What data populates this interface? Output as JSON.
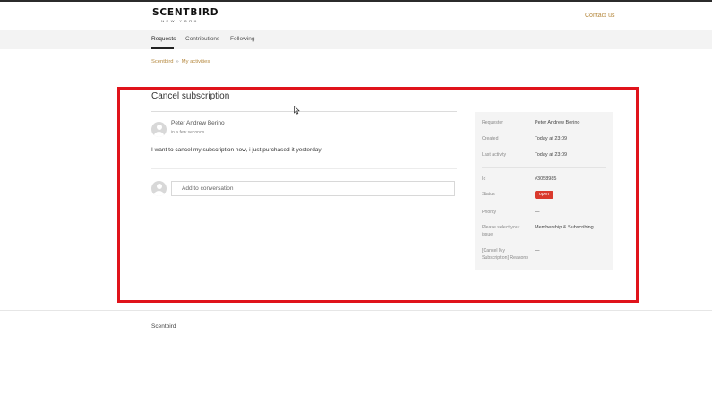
{
  "header": {
    "logo_text": "SCENTBIRD",
    "logo_subtext": "NEW YORK",
    "contact_label": "Contact us"
  },
  "nav": {
    "tabs": [
      {
        "label": "Requests",
        "active": true
      },
      {
        "label": "Contributions",
        "active": false
      },
      {
        "label": "Following",
        "active": false
      }
    ]
  },
  "breadcrumb": {
    "items": [
      "Scentbird",
      "My activities"
    ],
    "separator": "»"
  },
  "request": {
    "title": "Cancel subscription",
    "comment": {
      "author": "Peter Andrew Berino",
      "time": "in a few seconds",
      "body": "I want to cancel my subscription now, i just purchased it yesterday"
    },
    "reply_placeholder": "Add to conversation"
  },
  "details": {
    "requester_label": "Requester",
    "requester_value": "Peter Andrew Berino",
    "created_label": "Created",
    "created_value": "Today at 23:09",
    "activity_label": "Last activity",
    "activity_value": "Today at 23:09",
    "id_label": "Id",
    "id_value": "#3058985",
    "status_label": "Status",
    "status_value": "open",
    "priority_label": "Priority",
    "priority_value": "—",
    "issue_label": "Please select your issue",
    "issue_value": "Membership & Subscribing",
    "reasons_label": "[Cancel My Subscription] Reasons",
    "reasons_value": "—"
  },
  "footer": {
    "brand": "Scentbird"
  },
  "colors": {
    "accent": "#b5883e",
    "highlight_border": "#e0131b",
    "status_open": "#d9392c",
    "nav_background": "#f3f3f3",
    "panel_background": "#f4f4f4"
  }
}
